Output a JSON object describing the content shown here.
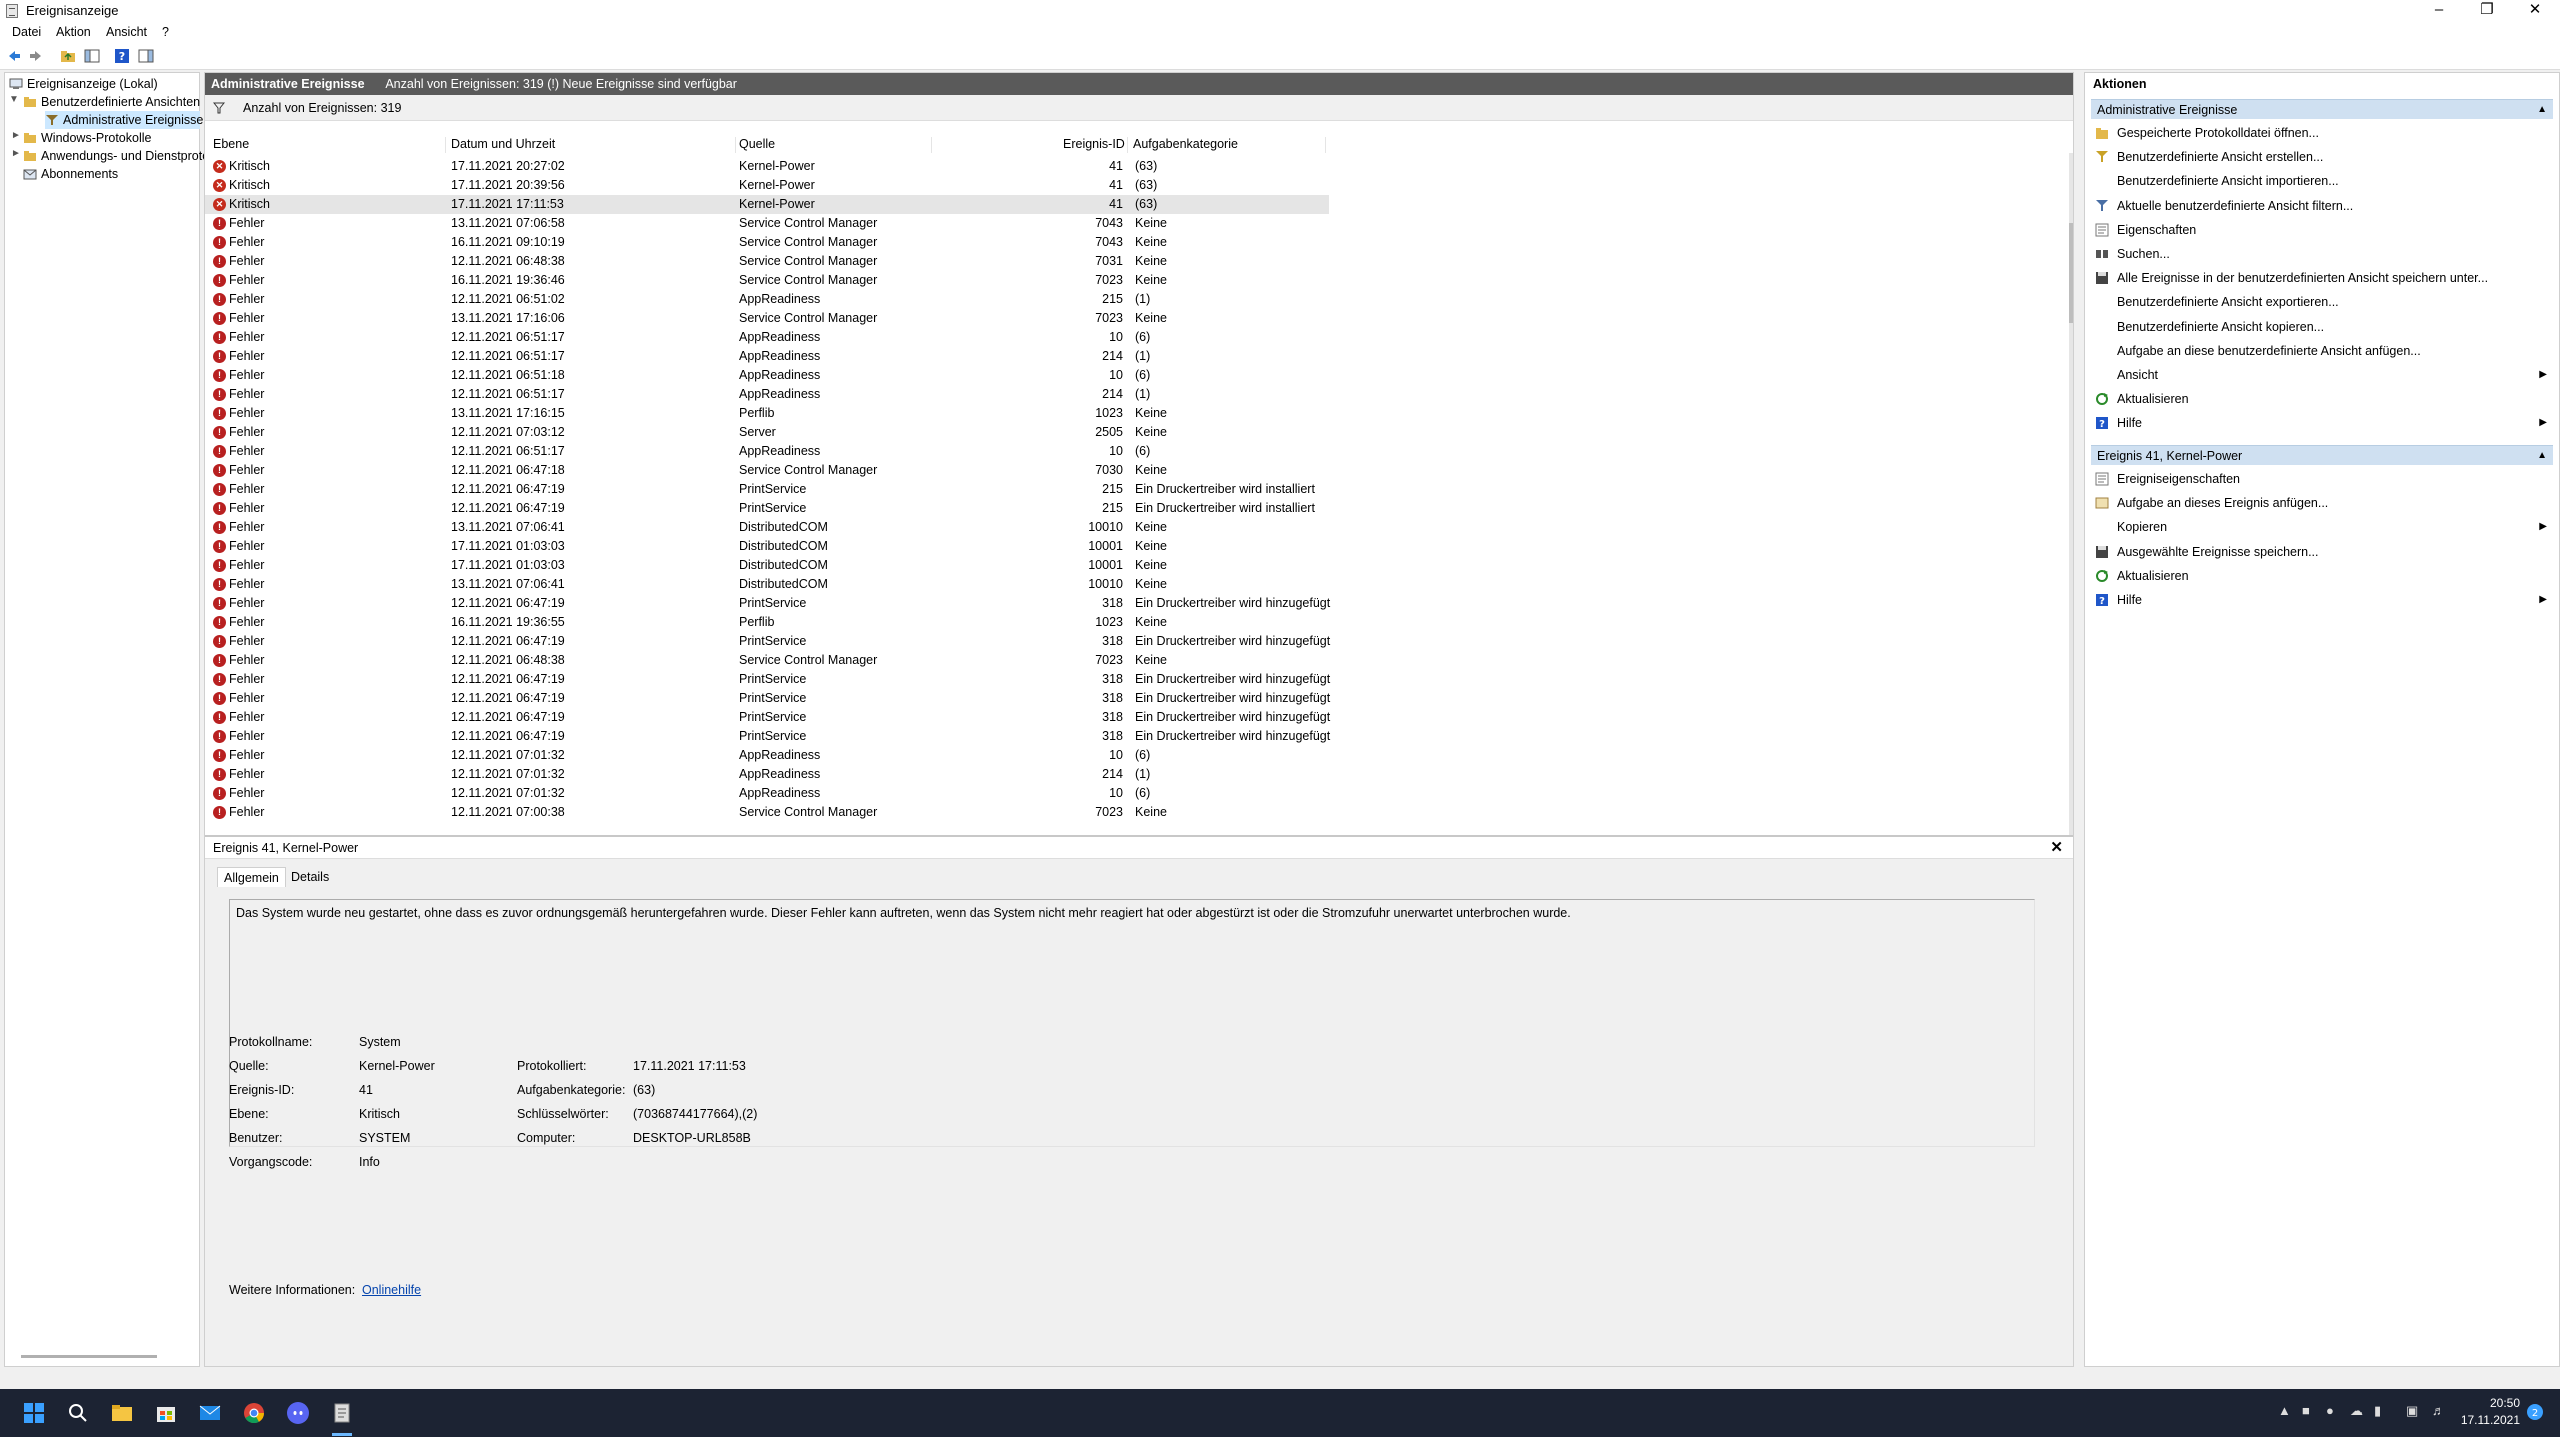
{
  "window": {
    "title": "Ereignisanzeige"
  },
  "menu": [
    "Datei",
    "Aktion",
    "Ansicht",
    "?"
  ],
  "tree": {
    "root": "Ereignisanzeige (Lokal)",
    "custom_views": "Benutzerdefinierte Ansichten",
    "admin_events": "Administrative Ereignisse",
    "windows_logs": "Windows-Protokolle",
    "app_logs": "Anwendungs- und Dienstprotokolle",
    "subscriptions": "Abonnements"
  },
  "center": {
    "header_title": "Administrative Ereignisse",
    "header_info": "Anzahl von Ereignissen: 319 (!) Neue Ereignisse sind verfügbar",
    "filter_text": "Anzahl von Ereignissen: 319",
    "columns": [
      "Ebene",
      "Datum und Uhrzeit",
      "Quelle",
      "Ereignis-ID",
      "Aufgabenkategorie"
    ],
    "rows": [
      [
        "Kritisch",
        "17.11.2021 20:27:02",
        "Kernel-Power",
        "41",
        "(63)"
      ],
      [
        "Kritisch",
        "17.11.2021 20:39:56",
        "Kernel-Power",
        "41",
        "(63)"
      ],
      [
        "Kritisch",
        "17.11.2021 17:11:53",
        "Kernel-Power",
        "41",
        "(63)"
      ],
      [
        "Fehler",
        "13.11.2021 07:06:58",
        "Service Control Manager",
        "7043",
        "Keine"
      ],
      [
        "Fehler",
        "16.11.2021 09:10:19",
        "Service Control Manager",
        "7043",
        "Keine"
      ],
      [
        "Fehler",
        "12.11.2021 06:48:38",
        "Service Control Manager",
        "7031",
        "Keine"
      ],
      [
        "Fehler",
        "16.11.2021 19:36:46",
        "Service Control Manager",
        "7023",
        "Keine"
      ],
      [
        "Fehler",
        "12.11.2021 06:51:02",
        "AppReadiness",
        "215",
        "(1)"
      ],
      [
        "Fehler",
        "13.11.2021 17:16:06",
        "Service Control Manager",
        "7023",
        "Keine"
      ],
      [
        "Fehler",
        "12.11.2021 06:51:17",
        "AppReadiness",
        "10",
        "(6)"
      ],
      [
        "Fehler",
        "12.11.2021 06:51:17",
        "AppReadiness",
        "214",
        "(1)"
      ],
      [
        "Fehler",
        "12.11.2021 06:51:18",
        "AppReadiness",
        "10",
        "(6)"
      ],
      [
        "Fehler",
        "12.11.2021 06:51:17",
        "AppReadiness",
        "214",
        "(1)"
      ],
      [
        "Fehler",
        "13.11.2021 17:16:15",
        "Perflib",
        "1023",
        "Keine"
      ],
      [
        "Fehler",
        "12.11.2021 07:03:12",
        "Server",
        "2505",
        "Keine"
      ],
      [
        "Fehler",
        "12.11.2021 06:51:17",
        "AppReadiness",
        "10",
        "(6)"
      ],
      [
        "Fehler",
        "12.11.2021 06:47:18",
        "Service Control Manager",
        "7030",
        "Keine"
      ],
      [
        "Fehler",
        "12.11.2021 06:47:19",
        "PrintService",
        "215",
        "Ein Druckertreiber wird installiert"
      ],
      [
        "Fehler",
        "12.11.2021 06:47:19",
        "PrintService",
        "215",
        "Ein Druckertreiber wird installiert"
      ],
      [
        "Fehler",
        "13.11.2021 07:06:41",
        "DistributedCOM",
        "10010",
        "Keine"
      ],
      [
        "Fehler",
        "17.11.2021 01:03:03",
        "DistributedCOM",
        "10001",
        "Keine"
      ],
      [
        "Fehler",
        "17.11.2021 01:03:03",
        "DistributedCOM",
        "10001",
        "Keine"
      ],
      [
        "Fehler",
        "13.11.2021 07:06:41",
        "DistributedCOM",
        "10010",
        "Keine"
      ],
      [
        "Fehler",
        "12.11.2021 06:47:19",
        "PrintService",
        "318",
        "Ein Druckertreiber wird hinzugefügt"
      ],
      [
        "Fehler",
        "16.11.2021 19:36:55",
        "Perflib",
        "1023",
        "Keine"
      ],
      [
        "Fehler",
        "12.11.2021 06:47:19",
        "PrintService",
        "318",
        "Ein Druckertreiber wird hinzugefügt"
      ],
      [
        "Fehler",
        "12.11.2021 06:48:38",
        "Service Control Manager",
        "7023",
        "Keine"
      ],
      [
        "Fehler",
        "12.11.2021 06:47:19",
        "PrintService",
        "318",
        "Ein Druckertreiber wird hinzugefügt"
      ],
      [
        "Fehler",
        "12.11.2021 06:47:19",
        "PrintService",
        "318",
        "Ein Druckertreiber wird hinzugefügt"
      ],
      [
        "Fehler",
        "12.11.2021 06:47:19",
        "PrintService",
        "318",
        "Ein Druckertreiber wird hinzugefügt"
      ],
      [
        "Fehler",
        "12.11.2021 06:47:19",
        "PrintService",
        "318",
        "Ein Druckertreiber wird hinzugefügt"
      ],
      [
        "Fehler",
        "12.11.2021 07:01:32",
        "AppReadiness",
        "10",
        "(6)"
      ],
      [
        "Fehler",
        "12.11.2021 07:01:32",
        "AppReadiness",
        "214",
        "(1)"
      ],
      [
        "Fehler",
        "12.11.2021 07:01:32",
        "AppReadiness",
        "10",
        "(6)"
      ],
      [
        "Fehler",
        "12.11.2021 07:00:38",
        "Service Control Manager",
        "7023",
        "Keine"
      ]
    ],
    "selected_row": 2
  },
  "detail": {
    "title": "Ereignis 41, Kernel-Power",
    "tabs": [
      "Allgemein",
      "Details"
    ],
    "description": "Das System wurde neu gestartet, ohne dass es zuvor ordnungsgemäß heruntergefahren wurde. Dieser Fehler kann auftreten, wenn das System nicht mehr reagiert hat oder abgestürzt ist oder die Stromzufuhr unerwartet unterbrochen wurde.",
    "props_left": [
      {
        "label": "Protokollname:",
        "value": "System"
      },
      {
        "label": "Quelle:",
        "value": "Kernel-Power"
      },
      {
        "label": "Ereignis-ID:",
        "value": "41"
      },
      {
        "label": "Ebene:",
        "value": "Kritisch"
      },
      {
        "label": "Benutzer:",
        "value": "SYSTEM"
      },
      {
        "label": "Vorgangscode:",
        "value": "Info"
      }
    ],
    "props_right": [
      {
        "label": "Protokolliert:",
        "value": "17.11.2021 17:11:53"
      },
      {
        "label": "Aufgabenkategorie:",
        "value": "(63)"
      },
      {
        "label": "Schlüsselwörter:",
        "value": "(70368744177664),(2)"
      },
      {
        "label": "Computer:",
        "value": "DESKTOP-URL858B"
      }
    ],
    "more_info_label": "Weitere Informationen:",
    "more_info_link": "Onlinehilfe"
  },
  "actions": {
    "title": "Aktionen",
    "section1": "Administrative Ereignisse",
    "items1": [
      {
        "label": "Gespeicherte Protokolldatei öffnen...",
        "icon": "open-log-icon",
        "arrow": false
      },
      {
        "label": "Benutzerdefinierte Ansicht erstellen...",
        "icon": "create-view-icon",
        "arrow": false
      },
      {
        "label": "Benutzerdefinierte Ansicht importieren...",
        "icon": "",
        "arrow": false
      },
      {
        "label": "Aktuelle benutzerdefinierte Ansicht filtern...",
        "icon": "filter-icon",
        "arrow": false
      },
      {
        "label": "Eigenschaften",
        "icon": "properties-icon",
        "arrow": false
      },
      {
        "label": "Suchen...",
        "icon": "find-icon",
        "arrow": false
      },
      {
        "label": "Alle Ereignisse in der benutzerdefinierten Ansicht speichern unter...",
        "icon": "save-icon",
        "arrow": false
      },
      {
        "label": "Benutzerdefinierte Ansicht exportieren...",
        "icon": "",
        "arrow": false
      },
      {
        "label": "Benutzerdefinierte Ansicht kopieren...",
        "icon": "",
        "arrow": false
      },
      {
        "label": "Aufgabe an diese benutzerdefinierte Ansicht anfügen...",
        "icon": "",
        "arrow": false
      },
      {
        "label": "Ansicht",
        "icon": "",
        "arrow": true
      },
      {
        "label": "Aktualisieren",
        "icon": "refresh-icon",
        "arrow": false
      },
      {
        "label": "Hilfe",
        "icon": "help-icon",
        "arrow": true
      }
    ],
    "section2": "Ereignis 41, Kernel-Power",
    "items2": [
      {
        "label": "Ereigniseigenschaften",
        "icon": "event-properties-icon",
        "arrow": false
      },
      {
        "label": "Aufgabe an dieses Ereignis anfügen...",
        "icon": "attach-task-icon",
        "arrow": false
      },
      {
        "label": "Kopieren",
        "icon": "copy-icon",
        "arrow": true
      },
      {
        "label": "Ausgewählte Ereignisse speichern...",
        "icon": "save-icon",
        "arrow": false
      },
      {
        "label": "Aktualisieren",
        "icon": "refresh-icon",
        "arrow": false
      },
      {
        "label": "Hilfe",
        "icon": "help-icon",
        "arrow": true
      }
    ]
  },
  "taskbar": {
    "time": "20:50",
    "date": "17.11.2021"
  },
  "colors": {
    "header_bg": "#5a5a5a",
    "section_bg": "#cfe0f1",
    "error_red": "#b82020",
    "taskbar_bg": "#1c2333",
    "accent": "#0078d4"
  }
}
